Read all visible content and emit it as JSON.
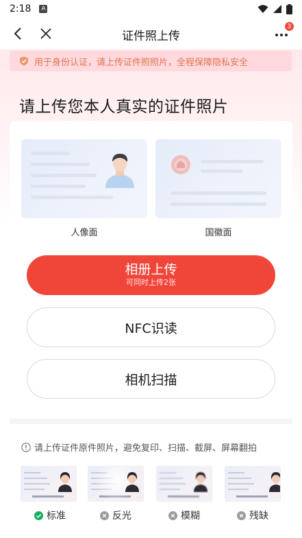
{
  "status_bar": {
    "time": "2:18",
    "notification_letter": "A",
    "icons": [
      "wifi-icon",
      "signal-icon",
      "battery-icon"
    ]
  },
  "nav": {
    "title": "证件照上传",
    "badge_count": "3"
  },
  "notice": {
    "text": "用于身份认证，请上传证件照照片，全程保障隐私安全"
  },
  "heading": "请上传您本人真实的证件照片",
  "id_sides": {
    "portrait_label": "人像面",
    "emblem_label": "国徽面"
  },
  "buttons": {
    "album_label": "相册上传",
    "album_sub": "可同时上传2张",
    "nfc_label": "NFC识读",
    "camera_label": "相机扫描"
  },
  "tip": "请上传证件原件照片，避免复印、扫描、截屏、屏幕翻拍",
  "examples": [
    {
      "label": "标准",
      "status": "ok"
    },
    {
      "label": "反光",
      "status": "bad"
    },
    {
      "label": "模糊",
      "status": "bad"
    },
    {
      "label": "残缺",
      "status": "bad"
    }
  ],
  "colors": {
    "accent": "#f0463a",
    "notice_text": "#e0744f",
    "ok_green": "#1aad5e",
    "bad_gray": "#9a9a9a"
  }
}
